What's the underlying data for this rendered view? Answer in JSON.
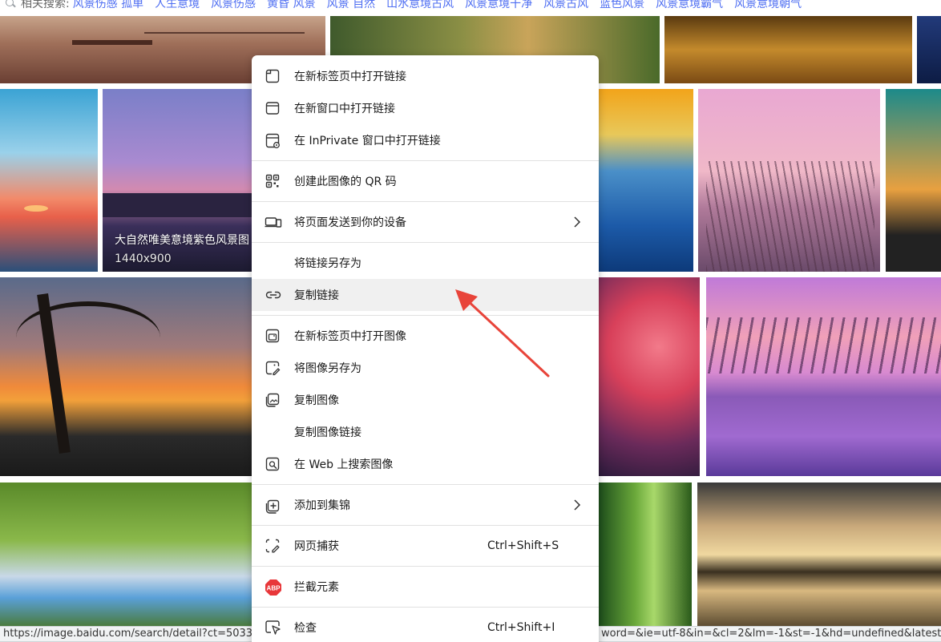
{
  "related": {
    "label": "相关搜索:",
    "keywords": [
      "风景伤感 孤单",
      "人生意境",
      "风景伤感",
      "黄昏 风景",
      "风景 自然",
      "山水意境古风",
      "风景意境干净",
      "风景古风",
      "蓝色风景",
      "风景意境霸气",
      "风景意境朝气"
    ]
  },
  "images": {
    "featured_caption": "大自然唯美意境紫色风景图",
    "featured_size": "1440x900"
  },
  "context_menu": {
    "groups": [
      [
        {
          "label": "在新标签页中打开链接",
          "icon": "new-tab-icon"
        },
        {
          "label": "在新窗口中打开链接",
          "icon": "new-window-icon"
        },
        {
          "label": "在 InPrivate 窗口中打开链接",
          "icon": "inprivate-icon"
        }
      ],
      [
        {
          "label": "创建此图像的 QR 码",
          "icon": "qr-code-icon"
        }
      ],
      [
        {
          "label": "将页面发送到你的设备",
          "icon": "send-to-device-icon",
          "submenu": true
        }
      ],
      [
        {
          "label": "将链接另存为",
          "icon": ""
        },
        {
          "label": "复制链接",
          "icon": "link-icon",
          "highlighted": true
        }
      ],
      [
        {
          "label": "在新标签页中打开图像",
          "icon": "open-image-icon"
        },
        {
          "label": "将图像另存为",
          "icon": "save-image-icon"
        },
        {
          "label": "复制图像",
          "icon": "copy-image-icon"
        },
        {
          "label": "复制图像链接",
          "icon": ""
        },
        {
          "label": "在 Web 上搜索图像",
          "icon": "visual-search-icon"
        }
      ],
      [
        {
          "label": "添加到集锦",
          "icon": "collections-icon",
          "submenu": true
        }
      ],
      [
        {
          "label": "网页捕获",
          "icon": "web-capture-icon",
          "shortcut": "Ctrl+Shift+S"
        }
      ],
      [
        {
          "label": "拦截元素",
          "icon": "abp-icon"
        }
      ],
      [
        {
          "label": "检查",
          "icon": "inspect-icon",
          "shortcut": "Ctrl+Shift+I"
        }
      ]
    ]
  },
  "status": {
    "left_url": "https://image.baidu.com/search/detail?ct=503316",
    "right_url": "word=&ie=utf-8&in=&cl=2&lm=-1&st=-1&hd=undefined&latest"
  },
  "colors": {
    "link_blue": "#4e6ef2",
    "highlight": "#f0f0f0",
    "arrow_red": "#e8443a",
    "abp_red": "#e8373a"
  }
}
